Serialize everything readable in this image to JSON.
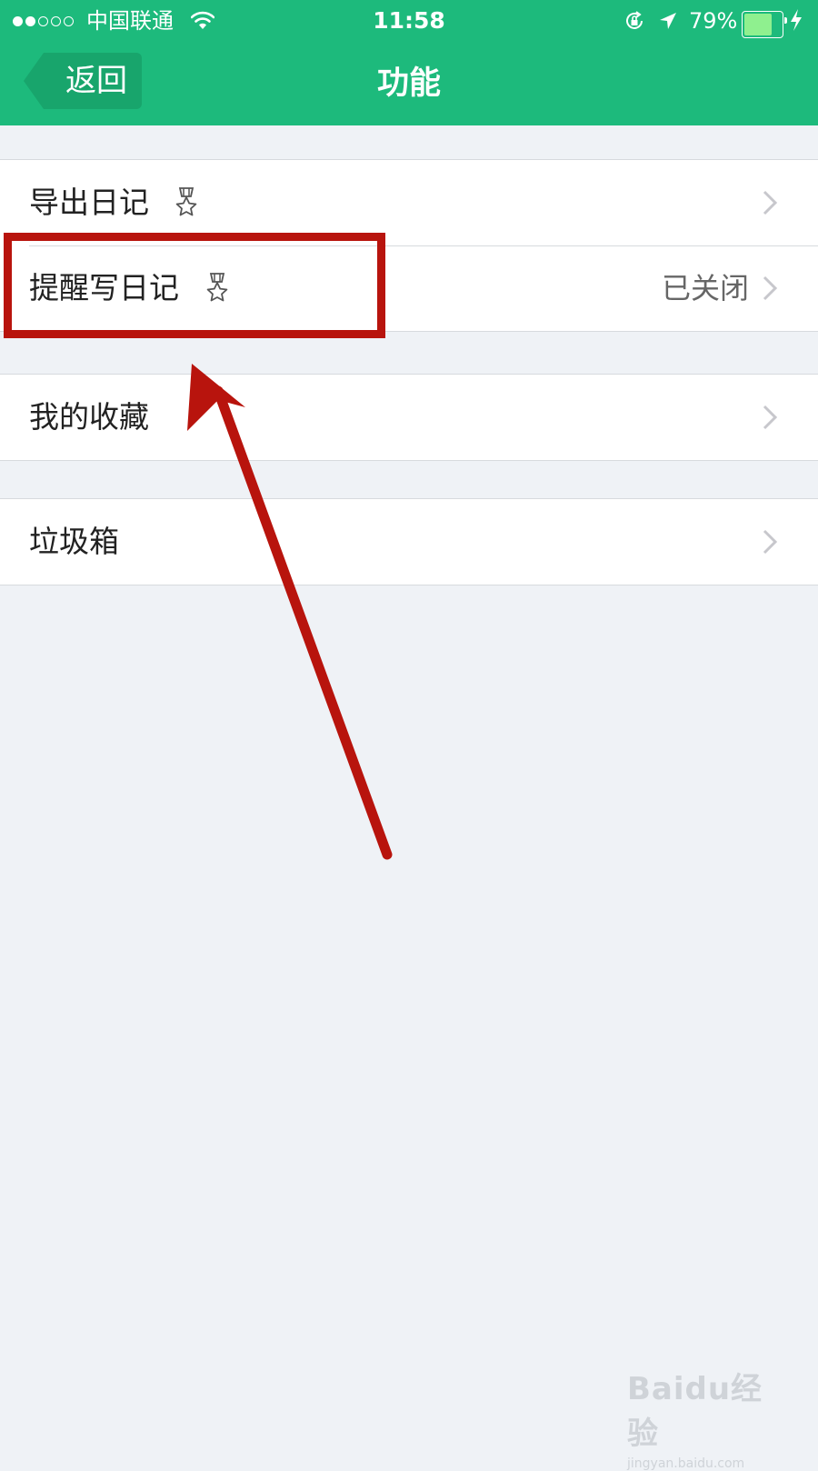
{
  "status_bar": {
    "carrier": "中国联通",
    "time": "11:58",
    "battery_percent": "79%",
    "battery_level": 0.79,
    "signal_strength": 2,
    "signal_max": 5
  },
  "nav": {
    "back_label": "返回",
    "title": "功能"
  },
  "groups": [
    {
      "rows": [
        {
          "label": "导出日记",
          "has_medal": true,
          "value": ""
        },
        {
          "label": "提醒写日记",
          "has_medal": true,
          "value": "已关闭"
        }
      ]
    },
    {
      "rows": [
        {
          "label": "我的收藏",
          "has_medal": false,
          "value": ""
        }
      ]
    },
    {
      "rows": [
        {
          "label": "垃圾箱",
          "has_medal": false,
          "value": ""
        }
      ]
    }
  ],
  "annotation": {
    "color": "#b8140d",
    "highlighted_row": "提醒写日记"
  },
  "watermark": {
    "logo": "Baidu经验",
    "url": "jingyan.baidu.com"
  },
  "colors": {
    "brand_green": "#1dba7c",
    "background": "#eff2f6"
  },
  "icons": {
    "medal": "medal-icon",
    "chevron": "chevron-right-icon",
    "back": "back-arrow-icon"
  }
}
